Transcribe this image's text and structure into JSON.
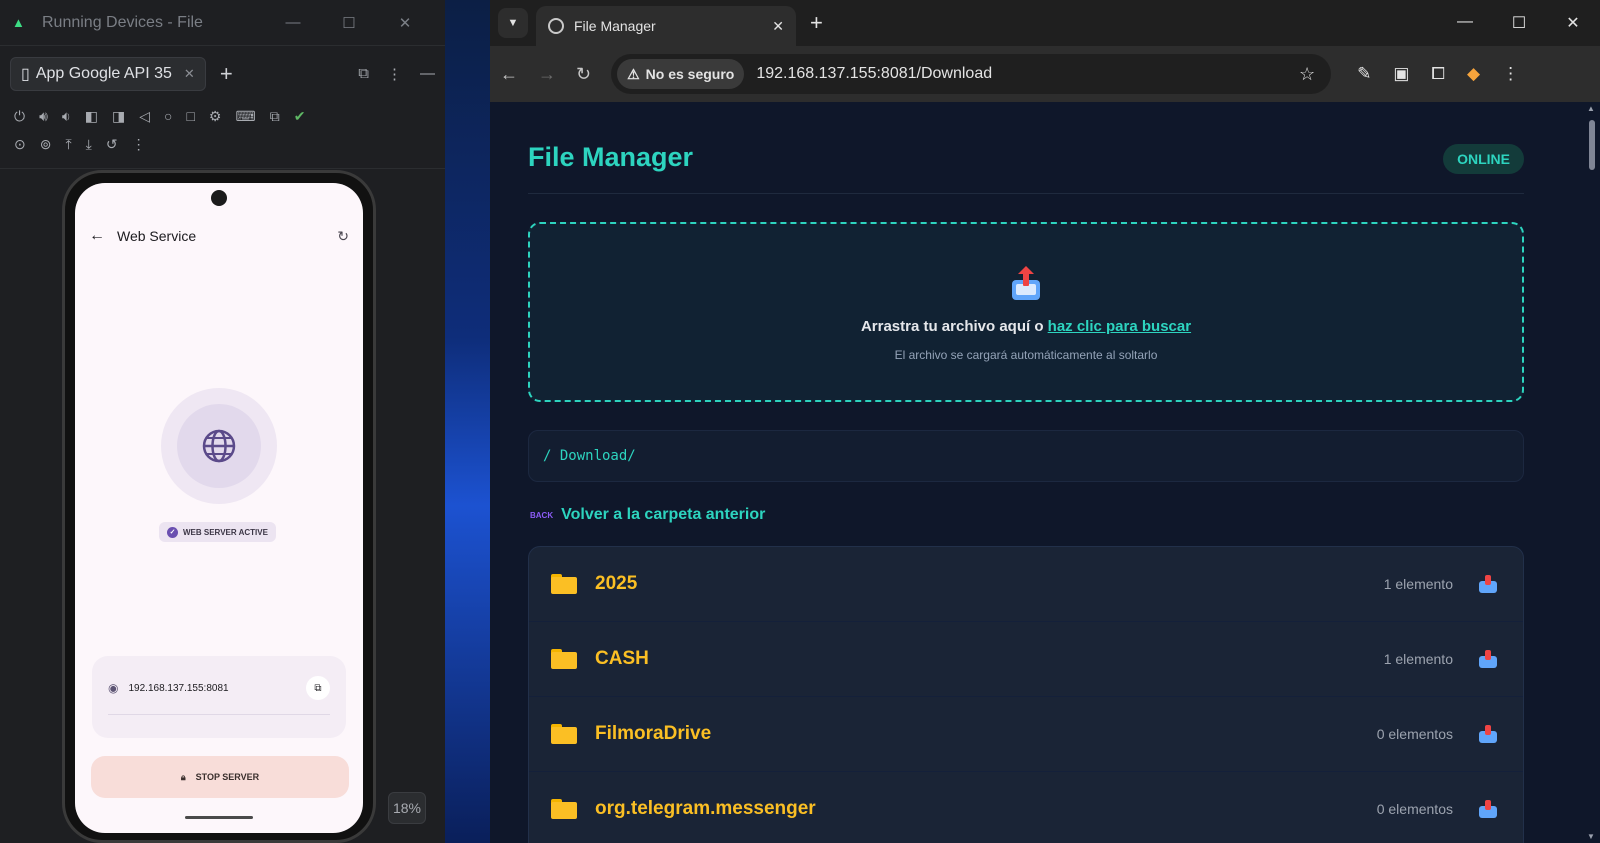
{
  "android_studio": {
    "window_title": "Running Devices - File",
    "tab_label": "App Google API 35",
    "zoom": "18%"
  },
  "phone": {
    "title": "Web Service",
    "status_chip": "WEB SERVER ACTIVE",
    "address": "192.168.137.155:8081",
    "stop_button": "STOP SERVER"
  },
  "browser": {
    "tab_title": "File Manager",
    "security_label": "No es seguro",
    "url": "192.168.137.155:8081/Download"
  },
  "page": {
    "title": "File Manager",
    "status": "ONLINE",
    "drop_text": "Arrastra tu archivo aquí o ",
    "drop_link": "haz clic para buscar",
    "drop_sub": "El archivo se cargará automáticamente al soltarlo",
    "path": "/ Download/",
    "back_link": "Volver a la carpeta anterior",
    "back_icon_text": "BACK",
    "items": [
      {
        "name": "2025",
        "count": "1 elemento"
      },
      {
        "name": "CASH",
        "count": "1 elemento"
      },
      {
        "name": "FilmoraDrive",
        "count": "0 elementos"
      },
      {
        "name": "org.telegram.messenger",
        "count": "0 elementos"
      }
    ]
  },
  "colors": {
    "accent": "#2dd4bf",
    "folder": "#fbbf24",
    "page_bg": "#0f172a"
  }
}
